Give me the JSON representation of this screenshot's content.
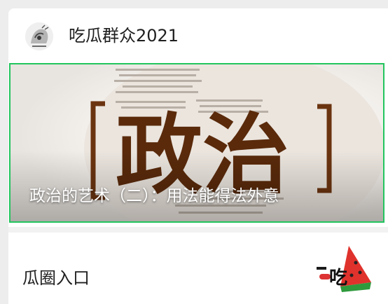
{
  "header": {
    "account_name": "吃瓜群众2021",
    "avatar_icon": "ink-cartoon-avatar-icon"
  },
  "banner": {
    "title": "政治的艺术（二）：用法能得法外意",
    "image_text": "政治",
    "image_icon": "politics-calligraphy-cover-image",
    "highlight_color": "#22c55e"
  },
  "entry": {
    "label": "瓜圈入口",
    "thumb_icon": "watermelon-chigua-logo-icon",
    "thumb_text": "吃"
  }
}
